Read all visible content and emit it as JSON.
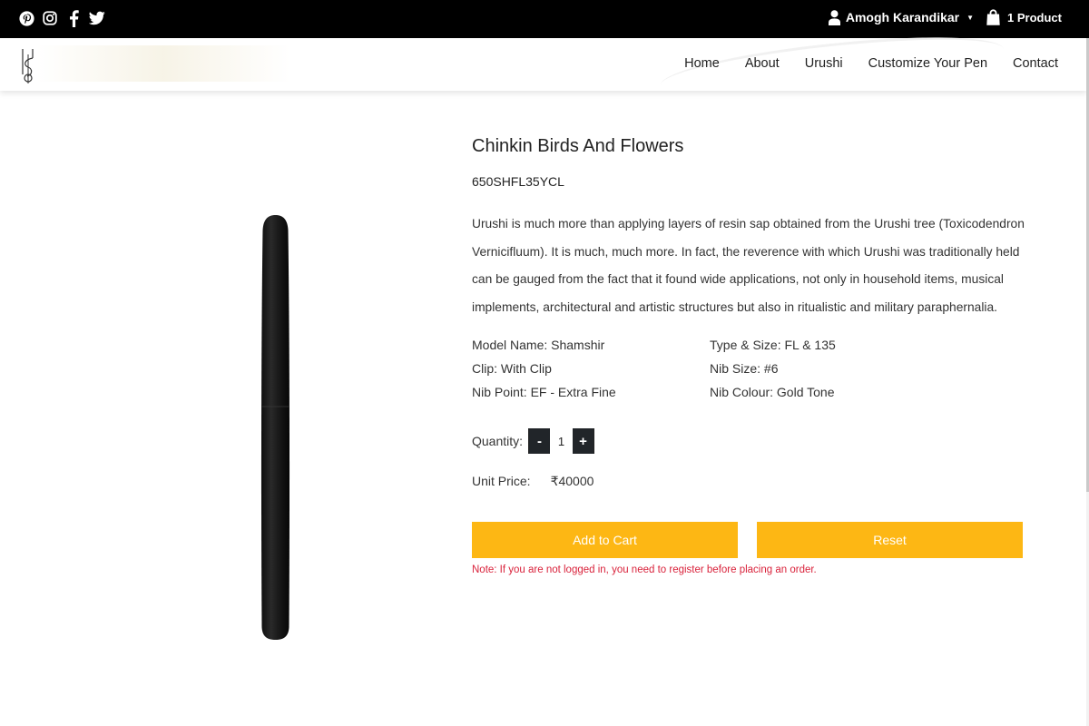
{
  "topbar": {
    "social_icons": [
      "pinterest-icon",
      "instagram-icon",
      "facebook-icon",
      "twitter-icon"
    ],
    "user_name": "Amogh Karandikar",
    "cart_label": "1 Product"
  },
  "nav": {
    "items": [
      "Home",
      "About",
      "Urushi",
      "Customize Your Pen",
      "Contact"
    ]
  },
  "product": {
    "title": "Chinkin Birds And Flowers",
    "sku": "650SHFL35YCL",
    "description": "Urushi is much more than applying layers of resin sap obtained from the Urushi tree (Toxicodendron Vernicifluum). It is much, much more. In fact, the reverence with which Urushi was traditionally held can be gauged from the fact that it found wide applications, not only in household items, musical implements, architectural and artistic structures but also in ritualistic and military paraphernalia.",
    "specs": [
      "Model Name: Shamshir",
      "Type & Size: FL & 135",
      "Clip: With Clip",
      "Nib Size: #6",
      "Nib Point: EF - Extra Fine",
      "Nib Colour: Gold Tone"
    ],
    "quantity_label": "Quantity:",
    "quantity_minus": "-",
    "quantity_value": "1",
    "quantity_plus": "+",
    "unit_price_label": "Unit Price:",
    "unit_price_value": "₹40000",
    "add_to_cart_label": "Add to Cart",
    "reset_label": "Reset",
    "note": "Note: If you are not logged in, you need to register before placing an order."
  },
  "colors": {
    "topbar_bg": "#000000",
    "accent": "#fdb714",
    "note_red": "#d9223b",
    "stepper_dark": "#212529"
  }
}
